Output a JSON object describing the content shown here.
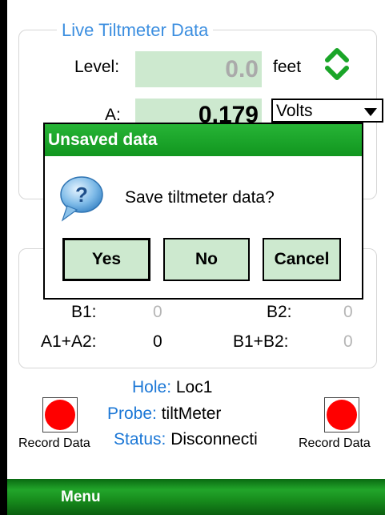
{
  "group": {
    "title": "Live Tiltmeter Data"
  },
  "level": {
    "label": "Level:",
    "value": "0.0",
    "unit": "feet"
  },
  "a": {
    "label": "A:",
    "value": "0.179",
    "unit_select": "Volts"
  },
  "sums": {
    "b1_label": "B1:",
    "b1_value": "0",
    "b2_label": "B2:",
    "b2_value": "0",
    "a1a2_label": "A1+A2:",
    "a1a2_value": "0",
    "b1b2_label": "B1+B2:",
    "b1b2_value": "0"
  },
  "info": {
    "hole_label": "Hole:",
    "hole_value": "Loc1",
    "probe_label": "Probe:",
    "probe_value": "tiltMeter",
    "status_label": "Status:",
    "status_value": "Disconnecti"
  },
  "record": {
    "left_label": "Record Data",
    "right_label": "Record Data"
  },
  "menubar": {
    "menu_label": "Menu"
  },
  "dialog": {
    "title": "Unsaved data",
    "message": "Save tiltmeter data?",
    "yes": "Yes",
    "no": "No",
    "cancel": "Cancel"
  },
  "colors": {
    "accent_blue": "#1b77d6",
    "title_green": "#1aa528",
    "field_green": "#cde9cf",
    "record_red": "#ff0000"
  }
}
